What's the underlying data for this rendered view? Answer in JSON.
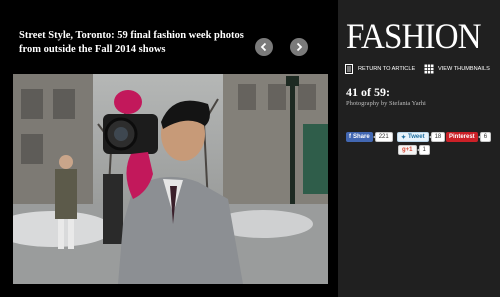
{
  "gallery": {
    "title": "Street Style, Toronto: 59 final fashion week photos from outside the Fall 2014 shows"
  },
  "nav": {
    "prev_icon": "chevron-left-icon",
    "next_icon": "chevron-right-icon"
  },
  "brand": {
    "logo_text": "FASHION"
  },
  "panel": {
    "return_label": "RETURN TO ARTICLE",
    "thumbnails_label": "VIEW THUMBNAILS",
    "counter": "41 of 59:",
    "credit": "Photography by Stefania Yarhi"
  },
  "share": {
    "facebook": {
      "label": "Share",
      "count": "221",
      "color": "#4267b2"
    },
    "twitter": {
      "label": "Tweet",
      "count": "18",
      "color": "#1f6fa0"
    },
    "pinterest": {
      "label": "Pinterest",
      "count": "6",
      "color": "#cb2027"
    },
    "google": {
      "label": "g+1",
      "count": "1",
      "color": "#d34836"
    }
  },
  "photo": {
    "subject": "man in grey suit photographing with camera, wearing pink gloves"
  }
}
